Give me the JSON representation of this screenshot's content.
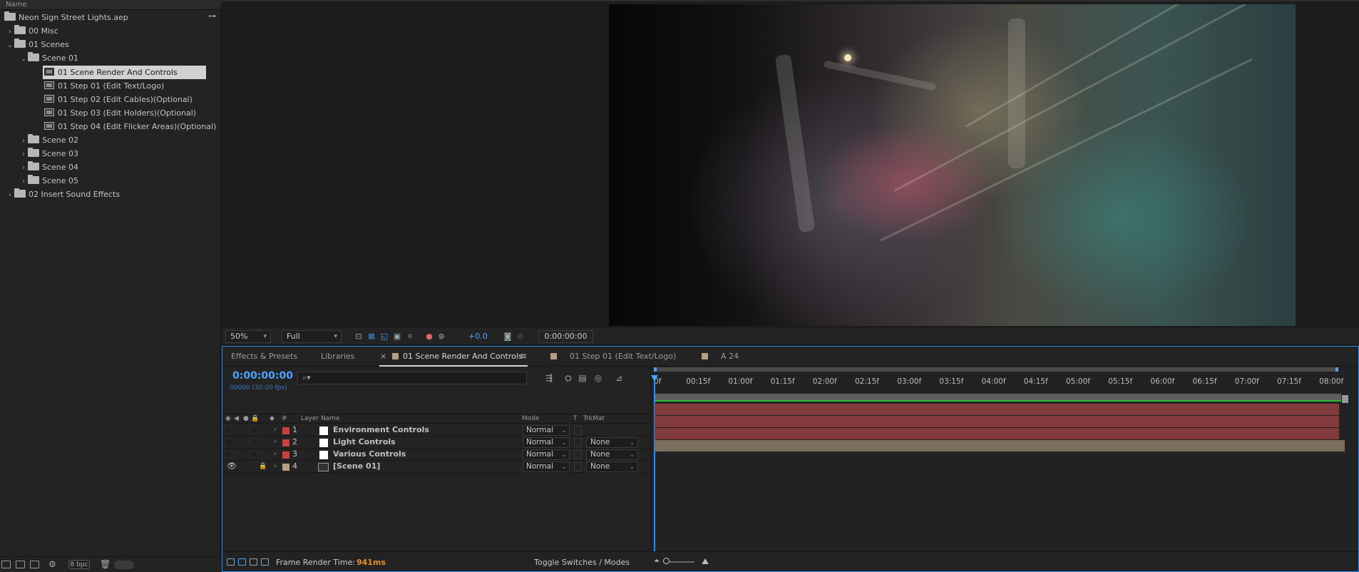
{
  "project": {
    "column_header": "Name",
    "items": [
      {
        "type": "file",
        "label": "Neon Sign Street Lights.aep"
      },
      {
        "type": "folder",
        "label": "00 Misc"
      },
      {
        "type": "folder",
        "label": "01 Scenes"
      },
      {
        "type": "folder",
        "label": "Scene 01"
      },
      {
        "type": "comp",
        "label": "01 Scene Render And Controls",
        "selected": true
      },
      {
        "type": "comp",
        "label": "01 Step 01 (Edit Text/Logo)"
      },
      {
        "type": "comp",
        "label": "01 Step 02 (Edit Cables)(Optional)"
      },
      {
        "type": "comp",
        "label": "01 Step 03 (Edit Holders)(Optional)"
      },
      {
        "type": "comp",
        "label": "01 Step 04 (Edit Flicker Areas)(Optional)"
      },
      {
        "type": "folder",
        "label": "Scene 02"
      },
      {
        "type": "folder",
        "label": "Scene 03"
      },
      {
        "type": "folder",
        "label": "Scene 04"
      },
      {
        "type": "folder",
        "label": "Scene 05"
      },
      {
        "type": "folder",
        "label": "02 Insert Sound Effects"
      }
    ],
    "bit_depth": "8 bpc",
    "icons": [
      "flowchart-icon",
      "new-folder-icon",
      "new-comp-icon",
      "project-settings-icon",
      "trash-icon"
    ]
  },
  "viewer": {
    "zoom": "50%",
    "resolution": "Full",
    "exposure": "+0.0",
    "timecode": "0:00:00:00"
  },
  "timeline": {
    "tabs": [
      {
        "label": "Effects & Presets"
      },
      {
        "label": "Libraries"
      },
      {
        "label": "01 Scene Render And Controls",
        "active": true,
        "color": "#b59e84"
      },
      {
        "label": "01 Step 01 (Edit Text/Logo)",
        "color": "#b59e84"
      },
      {
        "label": "A 24",
        "color": "#b59e84"
      }
    ],
    "current_time": "0:00:00:00",
    "frame_info": "00000 (30.00 fps)",
    "search_placeholder": "⌕▾",
    "columns": {
      "number": "#",
      "layer_name": "Layer Name",
      "mode": "Mode",
      "t": "T",
      "trkmat": "TrkMat"
    },
    "layers": [
      {
        "num": "1",
        "name": "Environment Controls",
        "label_color": "#c8413f",
        "mode": "Normal",
        "trkmat": "",
        "kind": "solid",
        "bar_color": "#833a3d"
      },
      {
        "num": "2",
        "name": "Light Controls",
        "label_color": "#c8413f",
        "mode": "Normal",
        "trkmat": "None",
        "kind": "solid",
        "bar_color": "#833a3d"
      },
      {
        "num": "3",
        "name": "Various Controls",
        "label_color": "#c8413f",
        "mode": "Normal",
        "trkmat": "None",
        "kind": "solid",
        "bar_color": "#833a3d"
      },
      {
        "num": "4",
        "name": "[Scene 01]",
        "label_color": "#b59e84",
        "mode": "Normal",
        "trkmat": "None",
        "kind": "comp",
        "bar_color": "#7c6e5e",
        "visible": true,
        "locked": true
      }
    ],
    "ruler": [
      "0f",
      "00:15f",
      "01:00f",
      "01:15f",
      "02:00f",
      "02:15f",
      "03:00f",
      "03:15f",
      "04:00f",
      "04:15f",
      "05:00f",
      "05:15f",
      "06:00f",
      "06:15f",
      "07:00f",
      "07:15f",
      "08:00f"
    ],
    "render_time_label": "Frame Render Time:",
    "render_time_value": "941ms",
    "toggle_label": "Toggle Switches / Modes"
  },
  "colors": {
    "accent": "#4aa3ff",
    "render_time": "#e8912b",
    "green_bar": "#2fbd3a"
  }
}
